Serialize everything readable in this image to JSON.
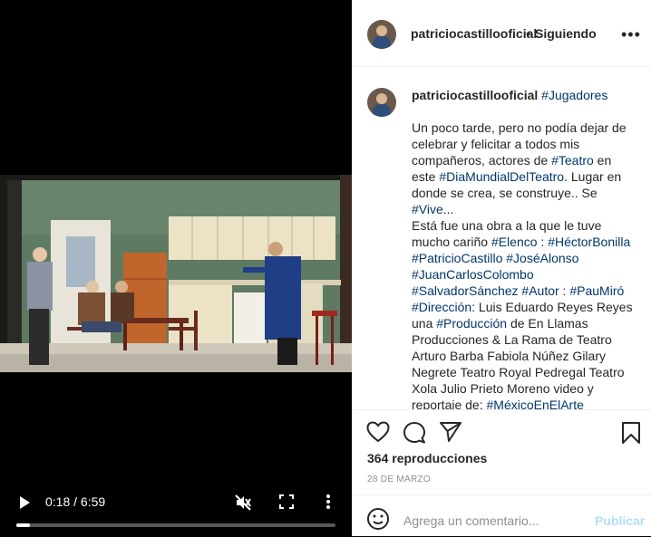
{
  "video": {
    "time_label": "0:18 / 6:59",
    "progress_fraction": 0.043
  },
  "header": {
    "username": "patriciocastillooficial",
    "separator": "•",
    "follow_status": "Siguiendo",
    "more_label": "•••"
  },
  "caption": {
    "username": "patriciocastillooficial",
    "title_tag": "#Jugadores",
    "segments": [
      {
        "t": "Un poco tarde, pero no podía dejar de celebrar y felicitar a todos mis compañeros, actores de "
      },
      {
        "t": "#Teatro",
        "tag": true
      },
      {
        "t": " en este "
      },
      {
        "t": "#DiaMundialDelTeatro",
        "tag": true
      },
      {
        "t": ". Lugar en donde se crea, se construye.. Se "
      },
      {
        "t": "#Vive",
        "tag": true
      },
      {
        "t": "...\nEstá fue una obra a la que le tuve mucho cariño "
      },
      {
        "t": "#Elenco",
        "tag": true
      },
      {
        "t": " : "
      },
      {
        "t": "#HéctorBonilla",
        "tag": true
      },
      {
        "t": " "
      },
      {
        "t": "#PatricioCastillo",
        "tag": true
      },
      {
        "t": " "
      },
      {
        "t": "#JoséAlonso",
        "tag": true
      },
      {
        "t": " "
      },
      {
        "t": "#JuanCarlosColombo",
        "tag": true
      },
      {
        "t": " "
      },
      {
        "t": "#SalvadorSánchez",
        "tag": true
      },
      {
        "t": " "
      },
      {
        "t": "#Autor",
        "tag": true
      },
      {
        "t": " : "
      },
      {
        "t": "#PauMiró",
        "tag": true
      },
      {
        "t": " "
      },
      {
        "t": "#Dirección",
        "tag": true
      },
      {
        "t": ": Luis Eduardo Reyes Reyes una "
      },
      {
        "t": "#Producción",
        "tag": true
      },
      {
        "t": " de En Llamas Producciones & La Rama de Teatro Arturo Barba Fabiola Núñez Gilary Negrete Teatro Royal Pedregal Teatro Xola Julio Prieto Moreno video y reportaje de: "
      },
      {
        "t": "#MéxicoEnElArte",
        "tag": true
      }
    ]
  },
  "stats": {
    "views": "364 reproducciones",
    "date": "28 DE MARZO"
  },
  "comment": {
    "placeholder": "Agrega un comentario...",
    "publish_label": "Publicar"
  },
  "colors": {
    "hashtag": "#00376b",
    "publish_disabled": "#b2dffc",
    "muted": "#8e8e8e",
    "text": "#262626"
  }
}
